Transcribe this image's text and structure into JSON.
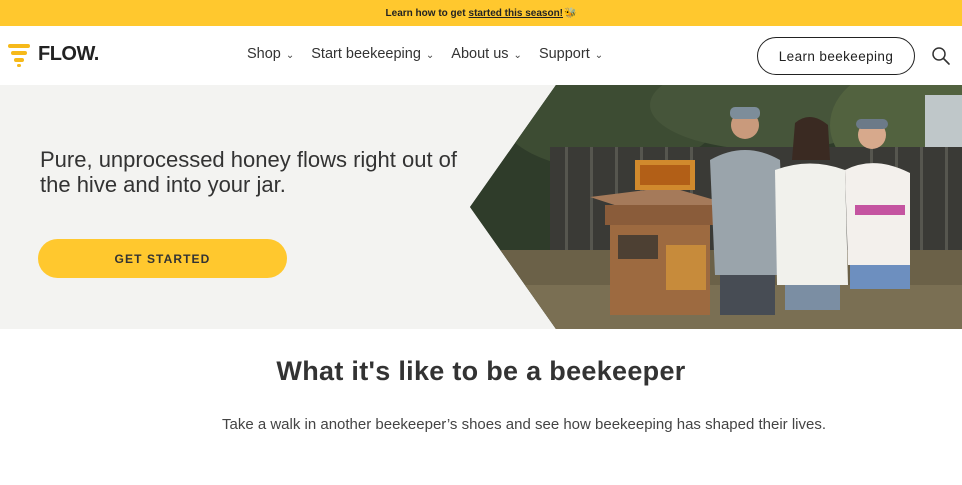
{
  "announcement": {
    "prefix": "Learn how to get",
    "link": "started this season!",
    "bee": "🐝"
  },
  "brand": {
    "name": "FLOW",
    "trademark": "."
  },
  "nav": {
    "items": [
      {
        "label": "Shop"
      },
      {
        "label": "Start beekeeping"
      },
      {
        "label": "About us"
      },
      {
        "label": "Support"
      }
    ],
    "chevron": "⌄",
    "learn_button": "Learn beekeeping",
    "search_icon": "search-icon"
  },
  "hero": {
    "headline": "Pure, unprocessed honey flows right out of the hive and into your jar.",
    "cta_label": "GET STARTED",
    "image_alt": "Family standing beside a Flow Hive in their garden"
  },
  "section": {
    "title": "What it's like to be a beekeeper",
    "subtitle": "Take a walk in another beekeeper’s shoes and see how beekeeping has shaped their lives."
  },
  "colors": {
    "accent": "#ffc82e",
    "hero_bg": "#f3f3f1",
    "text": "#333333"
  }
}
